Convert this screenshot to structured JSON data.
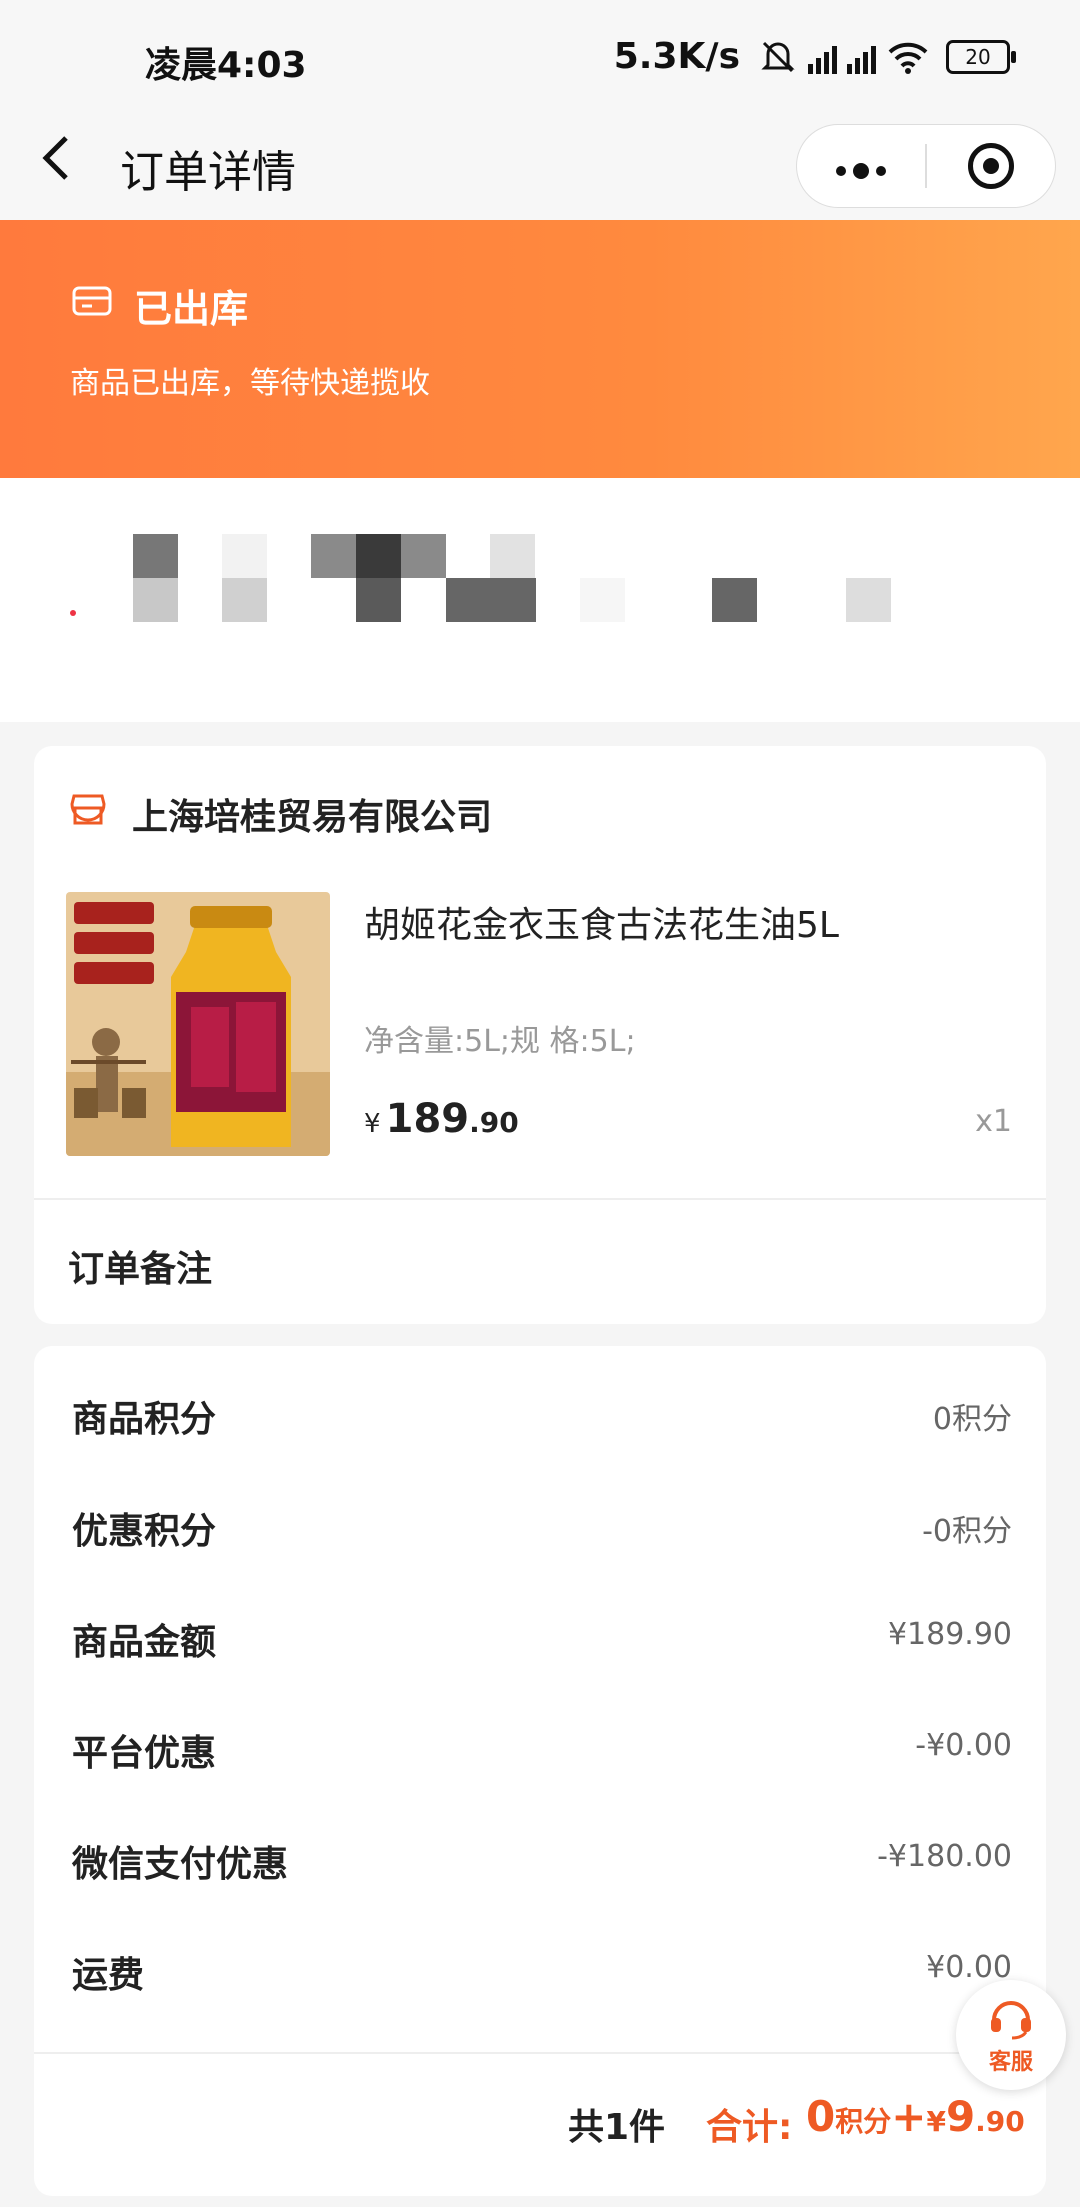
{
  "status_bar": {
    "time": "凌晨4:03",
    "speed": "5.3K/s",
    "battery": "20"
  },
  "nav": {
    "title": "订单详情",
    "back_icon": "chevron-left-icon",
    "more_icon": "more-dots-icon",
    "target_icon": "target-icon"
  },
  "banner": {
    "title": "已出库",
    "subtitle": "商品已出库，等待快递揽收",
    "icon": "shipping-box-icon",
    "colors": [
      "#ff7a3d",
      "#ffa64d"
    ]
  },
  "order": {
    "store_name": "上海培桂贸易有限公司",
    "store_icon": "store-icon",
    "product": {
      "name": "胡姬花金衣玉食古法花生油5L",
      "spec": "净含量:5L;规 格:5L;",
      "price_symbol": "¥",
      "price_int": "189",
      "price_dec": ".90",
      "qty": "x1"
    },
    "remark_label": "订单备注"
  },
  "summary": {
    "rows": [
      {
        "label": "商品积分",
        "value": "0积分"
      },
      {
        "label": "优惠积分",
        "value": "-0积分"
      },
      {
        "label": "商品金额",
        "value": "¥189.90"
      },
      {
        "label": "平台优惠",
        "value": "-¥0.00"
      },
      {
        "label": "微信支付优惠",
        "value": "-¥180.00"
      },
      {
        "label": "运费",
        "value": "¥0.00"
      }
    ],
    "count": "共1件",
    "total_label": "合计:",
    "total_points": "0",
    "total_points_unit": "积分",
    "total_plus": "+",
    "total_yen": "¥",
    "total_int": "9",
    "total_dec": ".90",
    "accent_color": "#ee5a24"
  },
  "service": {
    "label": "客服",
    "icon": "headset-icon"
  }
}
